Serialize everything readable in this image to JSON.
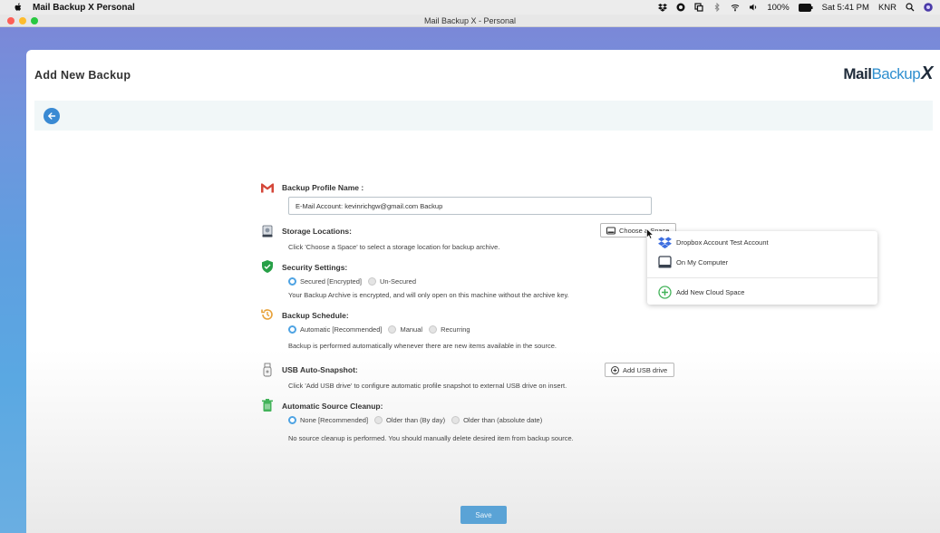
{
  "menubar": {
    "app_name": "Mail Backup X Personal",
    "battery": "100%",
    "clock": "Sat 5:41 PM",
    "keyboard": "KNR"
  },
  "window": {
    "title": "Mail Backup X - Personal"
  },
  "page": {
    "title": "Add New Backup",
    "logo_mail": "Mail",
    "logo_backup": "Backup",
    "logo_x": "X"
  },
  "form": {
    "profile_label": "Backup Profile Name :",
    "profile_value": "E-Mail Account: kevinrichgw@gmail.com Backup",
    "storage_label": "Storage Locations:",
    "storage_button": "Choose a Space",
    "storage_desc": "Click 'Choose a Space' to select a storage location for backup archive.",
    "security_label": "Security Settings:",
    "security_options": [
      "Secured [Encrypted]",
      "Un-Secured"
    ],
    "security_desc": "Your Backup Archive is encrypted, and will only open on this machine without the archive key.",
    "schedule_label": "Backup Schedule:",
    "schedule_options": [
      "Automatic [Recommended]",
      "Manual",
      "Recurring"
    ],
    "schedule_desc": "Backup is performed automatically whenever there are new items available in the source.",
    "usb_label": "USB Auto-Snapshot:",
    "usb_button": "Add USB drive",
    "usb_desc": "Click 'Add USB drive' to configure automatic profile snapshot to external USB drive on insert.",
    "cleanup_label": "Automatic Source Cleanup:",
    "cleanup_options": [
      "None [Recommended]",
      "Older than (By day)",
      "Older than (absolute date)"
    ],
    "cleanup_desc": "No source cleanup is performed. You should manually delete desired item from backup source.",
    "save": "Save"
  },
  "dropdown": {
    "items": [
      "Dropbox Account Test Account",
      "On My Computer",
      "Add New Cloud Space"
    ]
  },
  "colors": {
    "accent": "#3a8ad3",
    "radio_on": "#4ea3e3",
    "save_button": "#5aa3d6",
    "security_shield": "#27a047",
    "schedule_icon": "#e8a23a",
    "trash_icon": "#43b35a",
    "gmail_red": "#d44638"
  }
}
